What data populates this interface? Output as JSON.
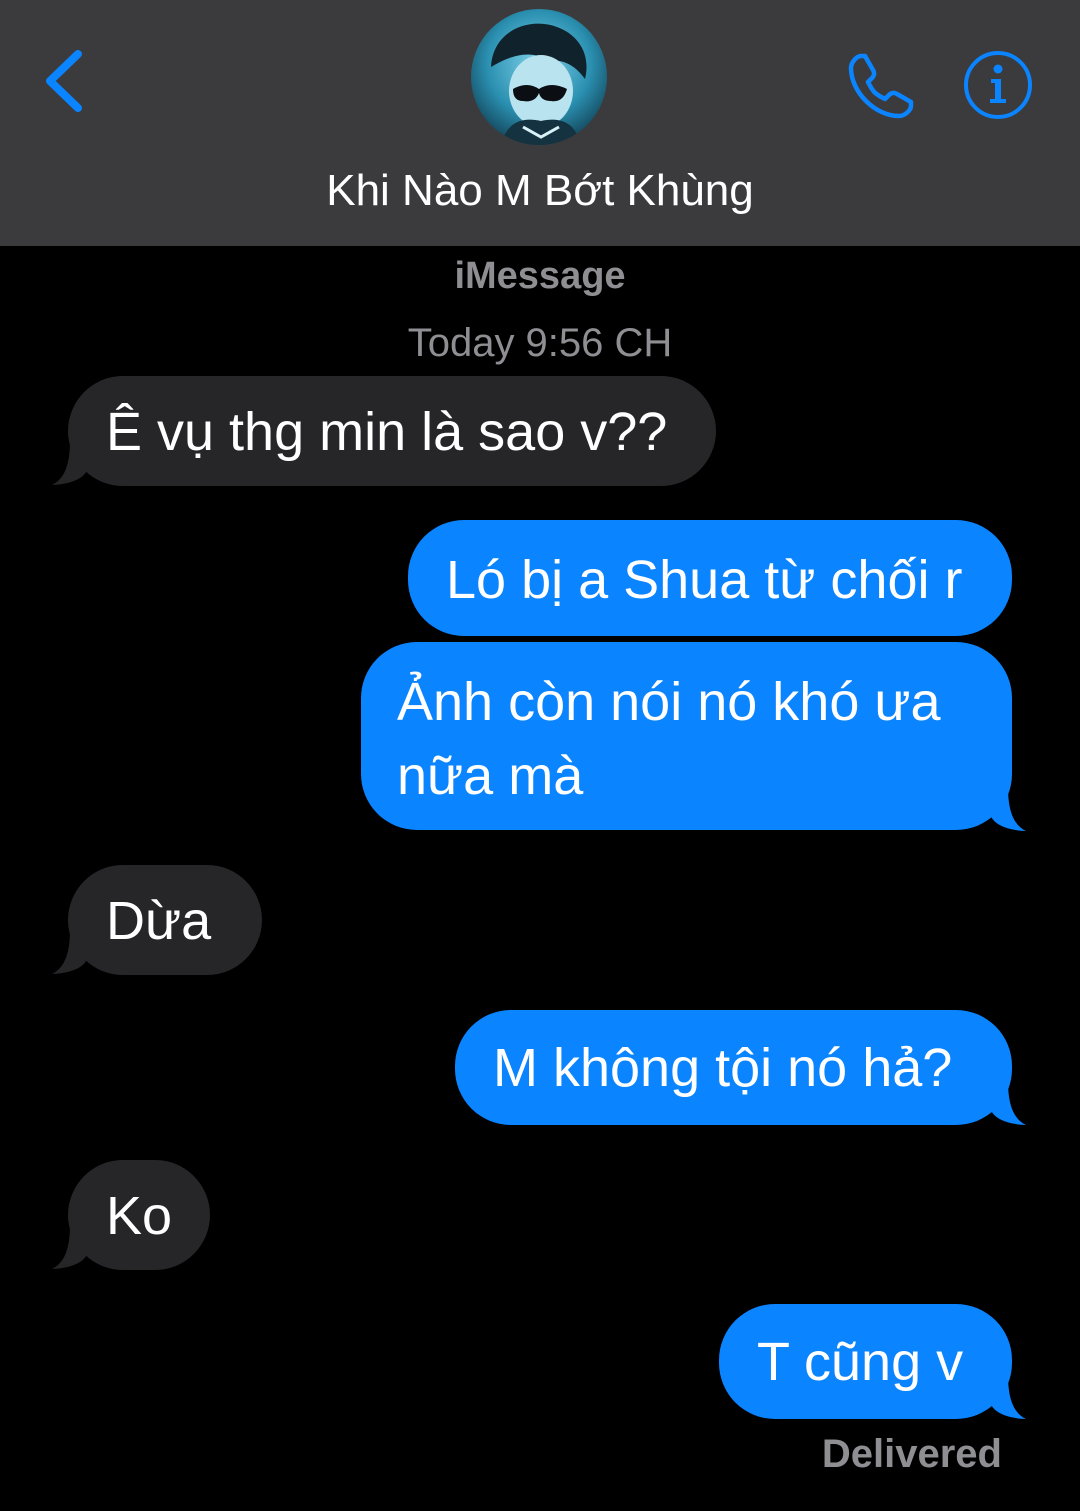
{
  "header": {
    "contact_name": "Khi Nào M Bớt Khùng",
    "back_icon": "chevron-left-icon",
    "call_icon": "phone-icon",
    "info_icon": "info-icon"
  },
  "thread": {
    "service": "iMessage",
    "timestamp": "Today 9:56 CH",
    "status": "Delivered"
  },
  "messages": [
    {
      "direction": "incoming",
      "lines": [
        "Ê vụ thg min là sao v??"
      ]
    },
    {
      "direction": "outgoing",
      "lines": [
        "Ló bị a Shua từ chối r"
      ]
    },
    {
      "direction": "outgoing",
      "lines": [
        "Ảnh còn nói nó khó ưa",
        "nữa mà"
      ]
    },
    {
      "direction": "incoming",
      "lines": [
        "Dừa"
      ]
    },
    {
      "direction": "outgoing",
      "lines": [
        "M không tội nó hả?"
      ]
    },
    {
      "direction": "incoming",
      "lines": [
        "Ko"
      ]
    },
    {
      "direction": "outgoing",
      "lines": [
        "T cũng v"
      ]
    }
  ],
  "colors": {
    "header_bg": "#3b3b3d",
    "accent": "#0a84ff",
    "incoming_bubble": "#262629",
    "outgoing_bubble": "#0a84ff",
    "secondary_text": "#8e8e93"
  }
}
